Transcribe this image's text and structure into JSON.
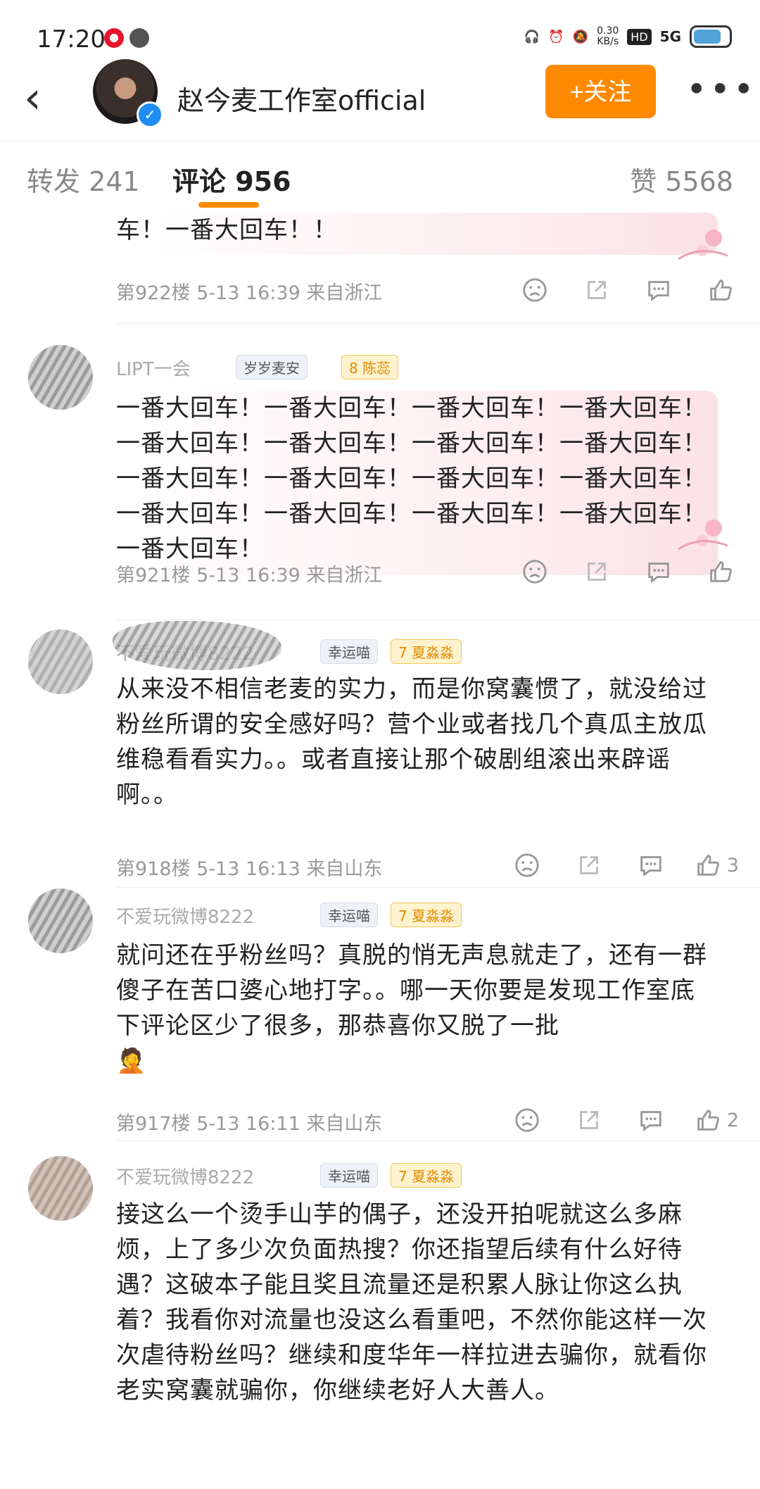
{
  "status": {
    "time": "17:20",
    "net_speed": "0.30",
    "net_unit": "KB/s",
    "hd": "HD",
    "signal": "5G"
  },
  "header": {
    "username": "赵今麦工作室official",
    "follow_label": "+关注",
    "more": "•••"
  },
  "tabs": {
    "repost": "转发 241",
    "comment": "评论 956",
    "like": "赞 5568"
  },
  "comments": [
    {
      "text": "车！一番大回车！！",
      "meta": "第922楼  5-13 16:39  来自浙江",
      "likes": ""
    },
    {
      "name": "LIPT一会",
      "badge1": "岁岁麦安",
      "badge2": "陈蕊",
      "badge2_level": "8",
      "text": "一番大回车！一番大回车！一番大回车！一番大回车！一番大回车！一番大回车！一番大回车！一番大回车！一番大回车！一番大回车！一番大回车！一番大回车！一番大回车！一番大回车！一番大回车！一番大回车！一番大回车！",
      "meta": "第921楼  5-13 16:39  来自浙江",
      "likes": ""
    },
    {
      "name": "不爱玩微博8222",
      "badge1": "幸运喵",
      "badge2": "夏淼淼",
      "badge2_level": "7",
      "text": "从来没不相信老麦的实力，而是你窝囊惯了，就没给过粉丝所谓的安全感好吗？营个业或者找几个真瓜主放瓜维稳看看实力。。或者直接让那个破剧组滚出来辟谣啊。。",
      "meta": "第918楼  5-13 16:13  来自山东",
      "likes": "3"
    },
    {
      "name": "不爱玩微博8222",
      "badge1": "幸运喵",
      "badge2": "夏淼淼",
      "badge2_level": "7",
      "text": "就问还在乎粉丝吗？真脱的悄无声息就走了，还有一群傻子在苦口婆心地打字。。哪一天你要是发现工作室底下评论区少了很多，那恭喜你又脱了一批",
      "emoji": "🤦",
      "meta": "第917楼  5-13 16:11  来自山东",
      "likes": "2"
    },
    {
      "name": "不爱玩微博8222",
      "badge1": "幸运喵",
      "badge2": "夏淼淼",
      "badge2_level": "7",
      "text": "接这么一个烫手山芋的偶子，还没开拍呢就这么多麻烦，上了多少次负面热搜？你还指望后续有什么好待遇？这破本子能且奖且流量还是积累人脉让你这么执着？我看你对流量也没这么看重吧，不然你能这样一次次虐待粉丝吗？继续和度华年一样拉进去骗你，就看你老实窝囊就骗你，你继续老好人大善人。"
    }
  ],
  "colors": {
    "accent": "#ff8a00",
    "verified": "#1e8cf0"
  },
  "icons": [
    "back-icon",
    "weibo-icon",
    "chat-bubble-icon",
    "headphones-icon",
    "alarm-icon",
    "mute-icon",
    "battery-icon",
    "verified-icon",
    "sad-face-icon",
    "share-icon",
    "comment-icon",
    "thumbs-up-icon"
  ]
}
